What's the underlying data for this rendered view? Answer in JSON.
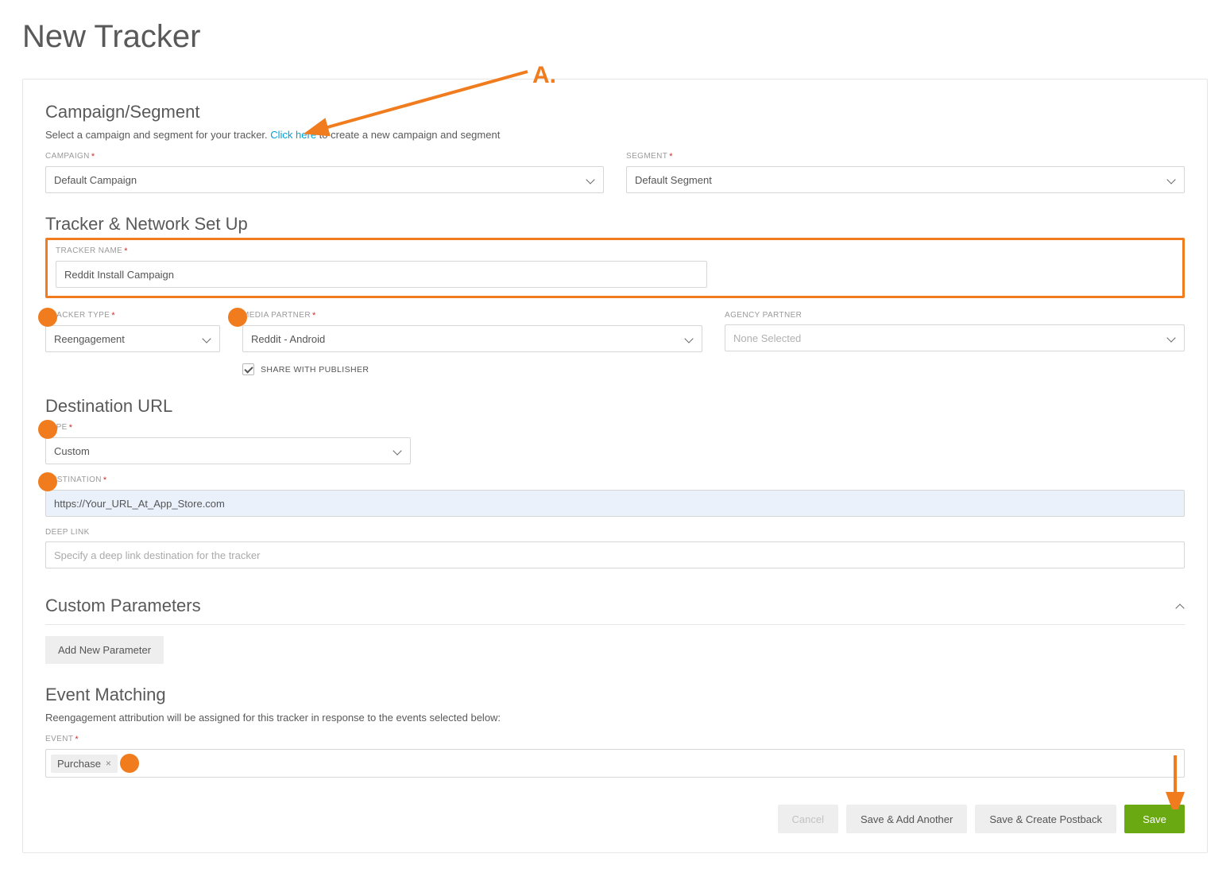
{
  "annotations": {
    "labelA": "A."
  },
  "page": {
    "title": "New Tracker"
  },
  "campaign_segment": {
    "title": "Campaign/Segment",
    "desc_prefix": "Select a campaign and segment for your tracker. ",
    "desc_link": "Click here",
    "desc_suffix": " to create a new campaign and segment",
    "campaign_label": "CAMPAIGN",
    "campaign_value": "Default Campaign",
    "segment_label": "SEGMENT",
    "segment_value": "Default Segment"
  },
  "tracker_network": {
    "title": "Tracker & Network Set Up",
    "name_label": "TRACKER NAME",
    "name_value": "Reddit Install Campaign",
    "type_label": "TRACKER TYPE",
    "type_value": "Reengagement",
    "media_label": "MEDIA PARTNER",
    "media_value": "Reddit - Android",
    "agency_label": "AGENCY PARTNER",
    "agency_value": "None Selected",
    "share_label": "SHARE WITH PUBLISHER"
  },
  "destination": {
    "title": "Destination URL",
    "type_label": "TYPE",
    "type_value": "Custom",
    "dest_label": "DESTINATION",
    "dest_value": "https://Your_URL_At_App_Store.com",
    "deep_label": "DEEP LINK",
    "deep_placeholder": "Specify a deep link destination for the tracker"
  },
  "custom_params": {
    "title": "Custom Parameters",
    "add_btn": "Add New Parameter"
  },
  "event_matching": {
    "title": "Event Matching",
    "desc": "Reengagement attribution will be assigned for this tracker in response to the events selected below:",
    "event_label": "EVENT",
    "tags": [
      "Purchase"
    ]
  },
  "buttons": {
    "cancel": "Cancel",
    "save_add": "Save & Add Another",
    "save_postback": "Save & Create Postback",
    "save": "Save"
  }
}
